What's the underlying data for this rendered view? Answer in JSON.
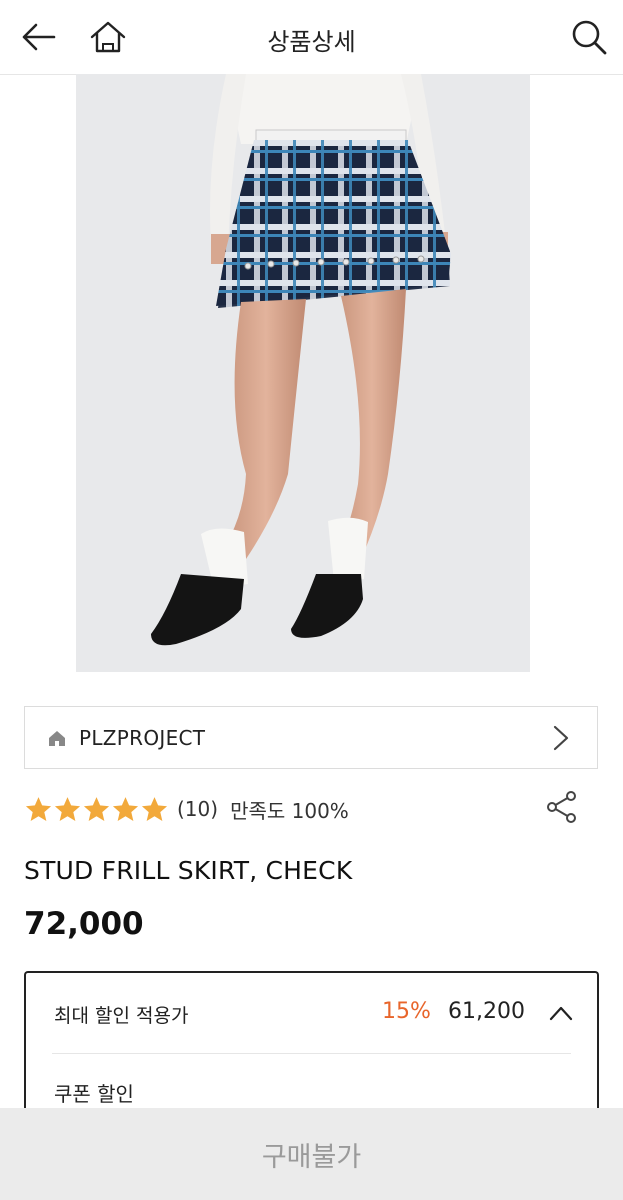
{
  "header": {
    "title": "상품상세",
    "back_icon": "back-arrow-icon",
    "home_icon": "home-icon",
    "search_icon": "search-icon"
  },
  "product": {
    "image_alt": "Plaid frill mini skirt worn by model",
    "brand": "PLZPROJECT",
    "rating_stars": 5,
    "review_count": "(10)",
    "satisfaction": "만족도 100%",
    "name": "STUD FRILL SKIRT, CHECK",
    "price": "72,000"
  },
  "discount": {
    "label": "최대 할인 적용가",
    "percent": "15%",
    "final_price": "61,200",
    "coupon_label": "쿠폰 할인"
  },
  "footer": {
    "buy_label": "구매불가"
  },
  "colors": {
    "accent": "#e8652b",
    "star": "#f2a93b"
  }
}
